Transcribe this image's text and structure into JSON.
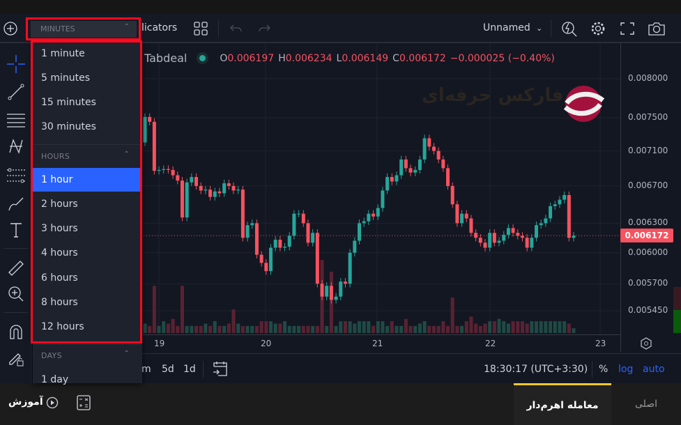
{
  "toolbar": {
    "indicators_label": "licators",
    "layout_name": "Unnamed",
    "interval_header": "MINUTES"
  },
  "symbol": {
    "exchange": "Tabdeal",
    "o_label": "O",
    "o": "0.006197",
    "h_label": "H",
    "h": "0.006234",
    "l_label": "L",
    "l": "0.006149",
    "c_label": "C",
    "c": "0.006172",
    "change": "−0.000025 (−0.40%)",
    "status_color": "#26a69a"
  },
  "watermark": {
    "text": "فارکس حرفه‌ای"
  },
  "dropdown": {
    "minutes_header": "MINUTES",
    "minutes": [
      "1 minute",
      "5 minutes",
      "15 minutes",
      "30 minutes"
    ],
    "hours_header": "HOURS",
    "hours": [
      "1 hour",
      "2 hours",
      "3 hours",
      "4 hours",
      "6 hours",
      "8 hours",
      "12 hours"
    ],
    "selected": "1 hour",
    "days_header": "DAYS",
    "days": [
      "1 day"
    ]
  },
  "bottombar": {
    "ranges": [
      "m",
      "5d",
      "1d"
    ],
    "clock": "18:30:17 (UTC+3:30)",
    "percent": "%",
    "log": "log",
    "auto": "auto"
  },
  "footer": {
    "tutorial": "آموزش",
    "tab_leverage": "معامله اهرم‌دار",
    "tab_main": "اصلی",
    "accent_color": "#f0c929"
  },
  "chart_data": {
    "type": "candlestick",
    "scale": "log",
    "ylim": [
      0.00535,
      0.00815
    ],
    "price_ticks": [
      "0.008000",
      "0.007500",
      "0.007100",
      "0.006700",
      "0.006300",
      "0.006000",
      "0.005700",
      "0.005450"
    ],
    "last_price": "0.006172",
    "x_ticks": [
      "19",
      "20",
      "21",
      "22",
      "23"
    ],
    "up_color": "#26a69a",
    "down_color": "#f7525f",
    "closes": [
      0.00751,
      0.00745,
      0.00687,
      0.00688,
      0.00689,
      0.00688,
      0.00682,
      0.00676,
      0.00636,
      0.00674,
      0.0068,
      0.0067,
      0.00665,
      0.00666,
      0.00658,
      0.00664,
      0.00662,
      0.00673,
      0.0067,
      0.00665,
      0.00666,
      0.00615,
      0.00628,
      0.0063,
      0.00598,
      0.0059,
      0.00582,
      0.00605,
      0.00613,
      0.00605,
      0.00606,
      0.00617,
      0.0064,
      0.0064,
      0.0063,
      0.0061,
      0.0062,
      0.0057,
      0.00558,
      0.00568,
      0.00555,
      0.00558,
      0.00572,
      0.0057,
      0.006,
      0.00612,
      0.0063,
      0.00632,
      0.0064,
      0.00637,
      0.00646,
      0.00665,
      0.0068,
      0.00675,
      0.00682,
      0.007,
      0.0069,
      0.00685,
      0.00688,
      0.007,
      0.00725,
      0.00715,
      0.0071,
      0.007,
      0.0069,
      0.0067,
      0.0065,
      0.0063,
      0.0064,
      0.00635,
      0.0062,
      0.00615,
      0.0061,
      0.00605,
      0.0062,
      0.0061,
      0.00612,
      0.00618,
      0.00625,
      0.0062,
      0.00617,
      0.00615,
      0.00605,
      0.00615,
      0.00628,
      0.0063,
      0.00635,
      0.00648,
      0.0065,
      0.00655,
      0.0066,
      0.00615,
      0.006172
    ],
    "volumes": [
      4,
      3,
      20,
      3,
      5,
      4,
      6,
      3,
      20,
      3,
      3,
      3,
      3,
      4,
      3,
      5,
      3,
      3,
      4,
      10,
      4,
      3,
      3,
      3,
      3,
      5,
      5,
      5,
      4,
      4,
      5,
      3,
      3,
      3,
      3,
      3,
      3,
      3,
      31,
      3,
      26,
      3,
      5,
      5,
      5,
      4,
      5,
      5,
      5,
      3,
      5,
      5,
      3,
      5,
      3,
      3,
      6,
      3,
      3,
      4,
      5,
      3,
      3,
      3,
      5,
      3,
      15,
      3,
      3,
      5,
      7,
      4,
      3,
      4,
      5,
      5,
      6,
      5,
      4,
      5,
      5,
      5,
      4,
      5,
      5,
      5,
      5,
      5,
      5,
      5,
      5,
      4,
      2
    ]
  }
}
